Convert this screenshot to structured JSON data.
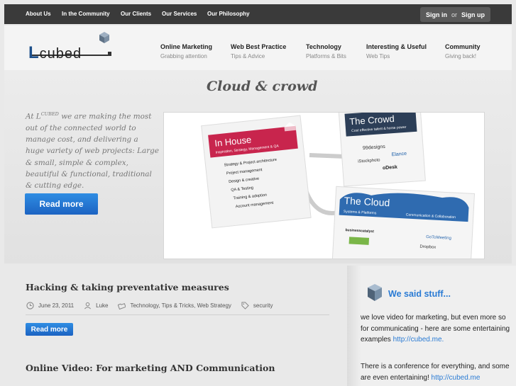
{
  "topnav": {
    "items": [
      "About Us",
      "In the Community",
      "Our Clients",
      "Our Services",
      "Our Philosophy"
    ],
    "signin": "Sign in",
    "or": "or",
    "signup": "Sign up"
  },
  "logo": {
    "text": "cubed"
  },
  "mainnav": [
    {
      "title": "Online Marketing",
      "sub": "Grabbing attention"
    },
    {
      "title": "Web Best Practice",
      "sub": "Tips & Advice"
    },
    {
      "title": "Technology",
      "sub": "Platforms & Bits"
    },
    {
      "title": "Interesting & Useful",
      "sub": "Web Tips"
    },
    {
      "title": "Community",
      "sub": "Giving back!"
    }
  ],
  "hero": {
    "title": "Cloud & crowd",
    "text_prefix": "At L",
    "text_sup": "CUBED",
    "text_rest": " we are making the most out of the connected world to manage cost, and delivering a huge variety of web projects: Large & small, simple & complex, beautiful & functional, traditional & cutting edge.",
    "button": "Read more",
    "image": {
      "inhouse_title": "In House",
      "inhouse_sub": "Inspiration, Strategy, Management & QA",
      "inhouse_items": [
        "Strategy & Project architecture",
        "Project management",
        "Design & creative",
        "QA & Testing",
        "Training & adoption",
        "Account management"
      ],
      "crowd_title": "The Crowd",
      "crowd_sub": "Cost effective talent & horse power",
      "crowd_logos": [
        "99designs",
        "Elance",
        "iStockphoto",
        "oDesk"
      ],
      "cloud_title": "The Cloud",
      "cloud_sub": "Systems & Platforms",
      "cloud_sub2": "Communication & Collaboration",
      "cloud_logos": [
        "businesscatalyst",
        "GoToMeeting",
        "Dropbox"
      ]
    }
  },
  "posts": [
    {
      "title": "Hacking & taking preventative measures",
      "date": "June 23, 2011",
      "author": "Luke",
      "categories": "Technology, Tips & Tricks, Web Strategy",
      "tags": "security",
      "button": "Read more"
    },
    {
      "title": "Online Video: For marketing AND Communication"
    }
  ],
  "sidebar": {
    "title": "We said stuff...",
    "p1": "we love video for marketing, but even more so for communicating - here are some entertaining examples ",
    "p1_link": "http://cubed.me.",
    "p2": "There is a conference for everything, and some are even entertaining! ",
    "p2_link": "http://cubed.me"
  }
}
